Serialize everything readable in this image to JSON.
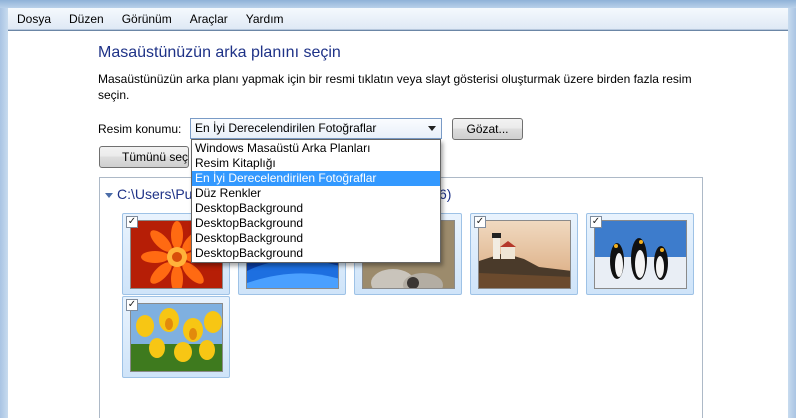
{
  "menu": [
    "Dosya",
    "Düzen",
    "Görünüm",
    "Araçlar",
    "Yardım"
  ],
  "page": {
    "heading": "Masaüstünüzün arka planını seçin",
    "description": "Masaüstünüzün arka planı yapmak için bir resmi tıklatın veya slayt gösterisi oluşturmak üzere birden fazla resim seçin."
  },
  "location": {
    "label": "Resim konumu:",
    "selected": "En İyi Derecelendirilen Fotoğraflar",
    "options": [
      "Windows Masaüstü Arka Planları",
      "Resim Kitaplığı",
      "En İyi Derecelendirilen Fotoğraflar",
      "Düz Renkler",
      "DesktopBackground",
      "DesktopBackground",
      "DesktopBackground",
      "DesktopBackground"
    ],
    "selected_index": 2
  },
  "buttons": {
    "browse": "Gözat...",
    "select_all": "Tümünü seç"
  },
  "gallery": {
    "folder_visible": "C:\\Users\\Pu",
    "count_visible": "6)",
    "checkmark": "✓",
    "thumbnails": [
      {
        "name": "orange-flower",
        "checked": true
      },
      {
        "name": "blue-abstract",
        "checked": true
      },
      {
        "name": "koala",
        "checked": true
      },
      {
        "name": "lighthouse",
        "checked": true
      },
      {
        "name": "penguins",
        "checked": true
      },
      {
        "name": "tulips",
        "checked": true
      }
    ]
  }
}
